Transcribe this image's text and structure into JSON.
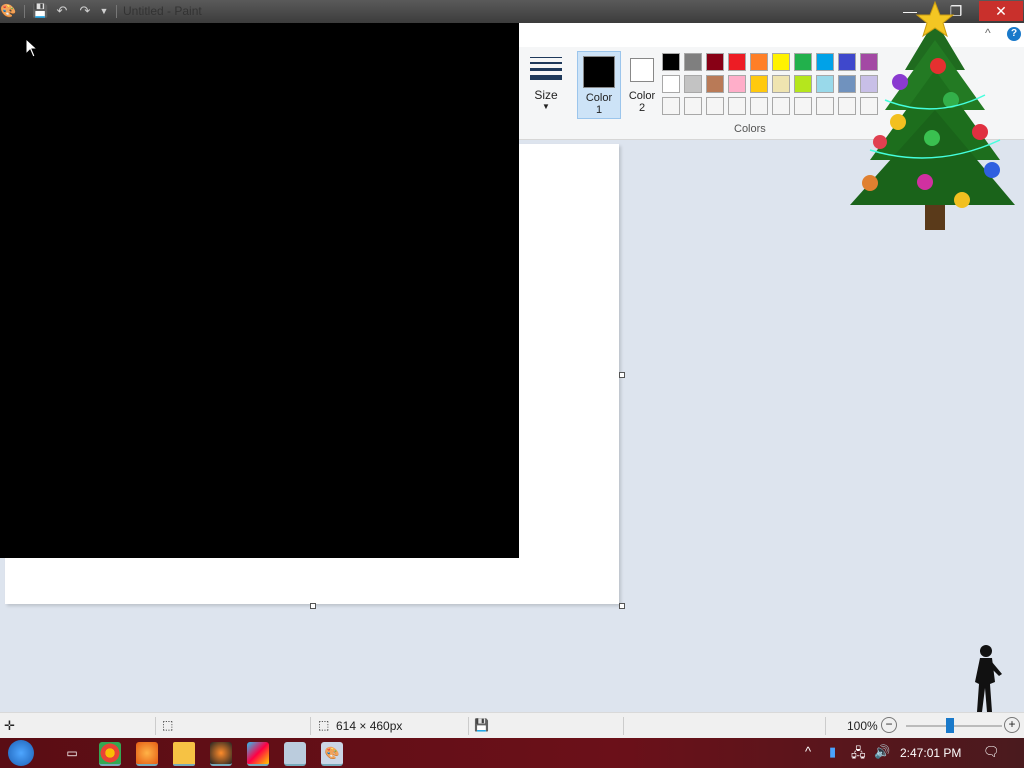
{
  "window": {
    "title": "Untitled - Paint",
    "minimize_glyph": "—",
    "maximize_glyph": "❐",
    "close_glyph": "✕"
  },
  "quick_access": {
    "app_icon": "paint-icon",
    "save_icon": "save-icon",
    "undo_icon": "undo-icon",
    "redo_icon": "redo-icon",
    "customize_icon": "dropdown-icon"
  },
  "ribbon": {
    "size_label": "Size",
    "color1_label_line1": "Color",
    "color1_label_line2": "1",
    "color2_label_line1": "Color",
    "color2_label_line2": "2",
    "colors_group_label": "Colors",
    "color1_value": "#000000",
    "color2_value": "#ffffff",
    "palette_row1": [
      "#000000",
      "#7f7f7f",
      "#880015",
      "#ed1c24",
      "#ff7f27",
      "#fff200",
      "#22b14c",
      "#00a2e8",
      "#3f48cc",
      "#a349a4"
    ],
    "palette_row2": [
      "#ffffff",
      "#c3c3c3",
      "#b97a57",
      "#ffaec9",
      "#ffc90e",
      "#efe4b0",
      "#b5e61d",
      "#99d9ea",
      "#7092be",
      "#c8bfe7"
    ],
    "palette_row3": [
      "#f5f5f5",
      "#f5f5f5",
      "#f5f5f5",
      "#f5f5f5",
      "#f5f5f5",
      "#f5f5f5",
      "#f5f5f5",
      "#f5f5f5",
      "#f5f5f5",
      "#f5f5f5"
    ],
    "help_glyph": "?",
    "collapse_glyph": "^"
  },
  "statusbar": {
    "canvas_size": "614 × 460px",
    "zoom": "100%",
    "zoom_out_glyph": "−",
    "zoom_in_glyph": "+"
  },
  "taskbar": {
    "clock": "2:47:01 PM"
  }
}
